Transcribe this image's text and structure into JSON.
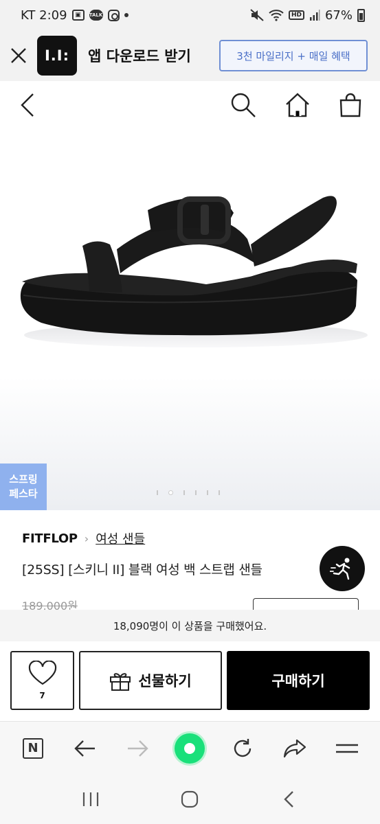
{
  "status_bar": {
    "carrier_time": "KT 2:09",
    "hd_label": "HD",
    "battery": "67%"
  },
  "app_banner": {
    "logo_text": "I.I:",
    "title": "앱 다운로드 받기",
    "cta_label": "3천 마일리지 + 매일 혜택"
  },
  "top_nav": {
    "icons": [
      "back-icon",
      "search-icon",
      "home-icon",
      "shopping-bag-icon"
    ]
  },
  "product_image": {
    "promo_badge_line1": "스프링",
    "promo_badge_line2": "페스타",
    "carousel": {
      "total": 6,
      "active_index": 1
    }
  },
  "product_info": {
    "brand": "FITFLOP",
    "category": "여성 샌들",
    "name": "[25SS] [스키니 II] 블랙 여성 백 스트랩 샌들",
    "original_price": "189,000원"
  },
  "purchase_notice": "18,090명이 이 상품을 구매했어요.",
  "action_bar": {
    "wish_count": "7",
    "gift_label": "선물하기",
    "buy_label": "구매하기"
  },
  "browser_bar": {
    "n_label": "N"
  },
  "colors": {
    "banner_button_border": "#6f8fd4",
    "promo_badge": "#8fb1ee",
    "browser_green": "#19e07a",
    "buy_button": "#000000"
  }
}
